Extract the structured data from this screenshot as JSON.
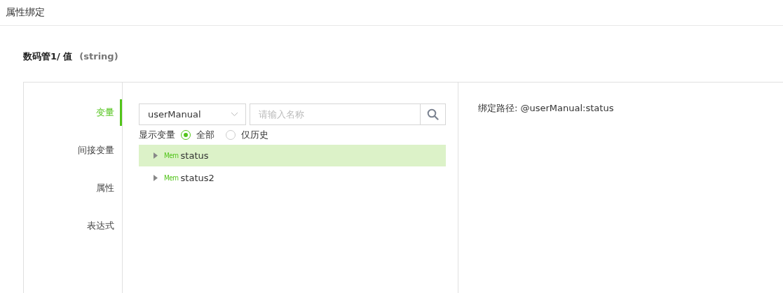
{
  "header": {
    "title": "属性绑定"
  },
  "binding": {
    "name": "数码管1/ 值",
    "type": "(string)"
  },
  "nav": [
    {
      "label": "变量",
      "selected": true
    },
    {
      "label": "间接变量",
      "selected": false
    },
    {
      "label": "属性",
      "selected": false
    },
    {
      "label": "表达式",
      "selected": false
    }
  ],
  "source_select": {
    "value": "userManual"
  },
  "search": {
    "placeholder": "请输入名称"
  },
  "filter": {
    "label": "显示变量",
    "options": [
      {
        "label": "全部",
        "selected": true
      },
      {
        "label": "仅历史",
        "selected": false
      }
    ]
  },
  "tree": [
    {
      "tag": "Mem",
      "label": "status",
      "selected": true,
      "expanded": false
    },
    {
      "tag": "Mem",
      "label": "status2",
      "selected": false,
      "expanded": false
    }
  ],
  "path": {
    "label": "绑定路径: @userManual:status"
  }
}
